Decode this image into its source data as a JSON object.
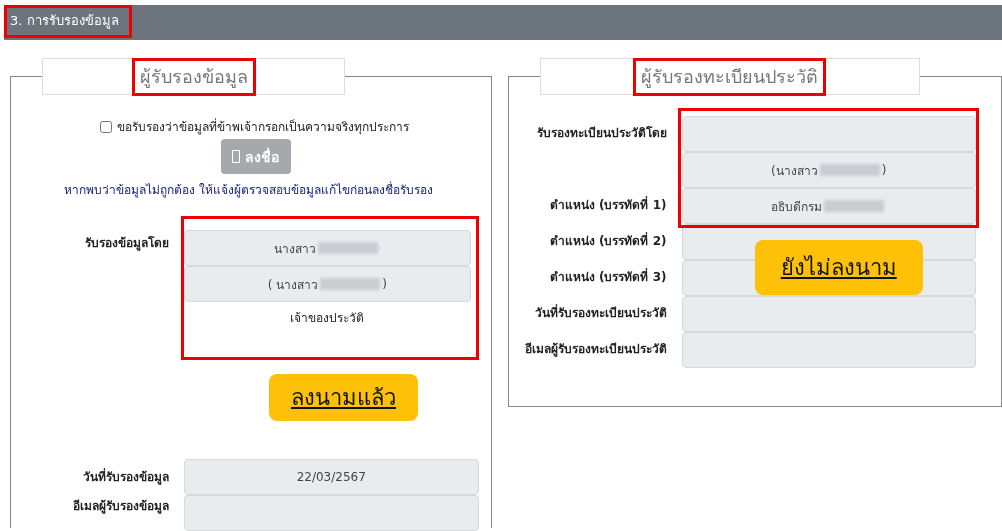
{
  "section_header": {
    "title": "3. การรับรองข้อมูล",
    "highlighted": true
  },
  "left_panel": {
    "legend": {
      "title": "ผู้รับรองข้อมูล",
      "highlighted": true
    },
    "consent": {
      "label": "ขอรับรองว่าข้อมูลที่ข้าพเจ้ากรอกเป็นความจริงทุกประการ",
      "checked": false
    },
    "sign_button": {
      "label": "ลงชื่อ",
      "disabled": true
    },
    "notice": "หากพบว่าข้อมูลไม่ถูกต้อง ให้แจ้งผู้ตรวจสอบข้อมูลแก้ไขก่อนลงชื่อรับรอง",
    "signer": {
      "label": "รับรองข้อมูลโดย",
      "highlighted": true,
      "fields": [
        {
          "value": "นางสาว",
          "redacted": true
        },
        {
          "value": "( นางสาว",
          "suffix": ")",
          "redacted": true
        }
      ],
      "caption": "เจ้าของประวัติ"
    },
    "status_badge": {
      "text": "ลงนามแล้ว"
    },
    "rows": [
      {
        "label": "วันที่รับรองข้อมูล",
        "value": "22/03/2567"
      },
      {
        "label": "อีเมลผู้รับรองข้อมูล"
      }
    ]
  },
  "right_panel": {
    "legend": {
      "title": "ผู้รับรองทะเบียนประวัติ",
      "highlighted": true
    },
    "signer_highlighted": true,
    "rows": [
      {
        "label": "รับรองทะเบียนประวัติโดย"
      },
      {
        "value": "(นางสาว",
        "suffix": ")",
        "redacted": true
      },
      {
        "label": "ตำแหน่ง (บรรทัดที่ 1)",
        "value": "อธิบดีกรม",
        "redacted": true
      },
      {
        "label": "ตำแหน่ง (บรรทัดที่ 2)"
      },
      {
        "label": "ตำแหน่ง (บรรทัดที่ 3)"
      },
      {
        "label": "วันที่รับรองทะเบียนประวัติ"
      },
      {
        "label": "อีเมลผู้รับรองทะเบียนประวัติ"
      }
    ],
    "status_badge": {
      "text": "ยังไม่ลงนาม"
    }
  }
}
